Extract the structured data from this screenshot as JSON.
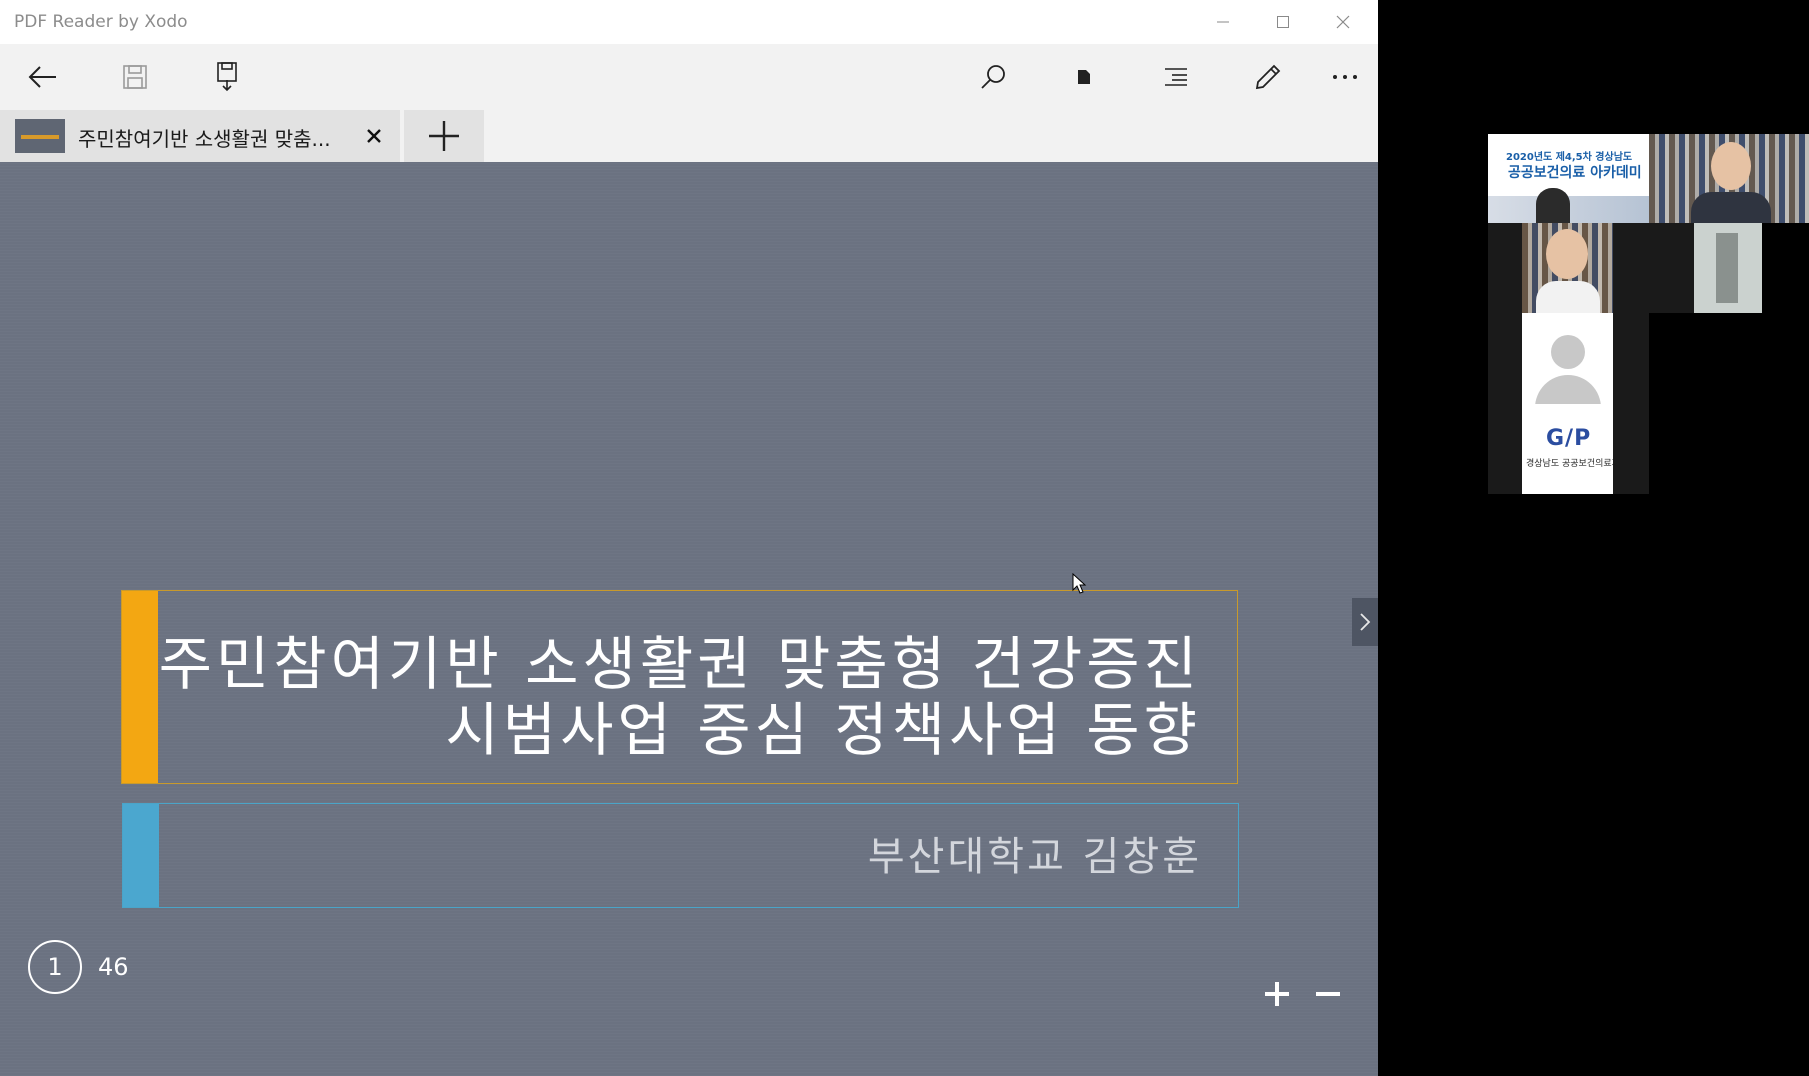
{
  "window": {
    "title": "PDF Reader by Xodo"
  },
  "toolbar": {
    "icons": [
      "back-arrow-icon",
      "save-icon",
      "save-as-icon",
      "search-icon",
      "bookmark-icon",
      "outline-icon",
      "pencil-icon",
      "more-icon"
    ]
  },
  "tab": {
    "title": "주민참여기반 소생활권 맞춤...",
    "close_icon": "close-icon",
    "new_tab_icon": "plus-icon"
  },
  "slide": {
    "title_line1": "주민참여기반 소생활권 맞춤형 건강증진",
    "title_line2": "시범사업 중심 정책사업 동향",
    "subtitle": "부산대학교 김창훈",
    "title_accent_color": "#f3a712",
    "subtitle_accent_color": "#4ba7cf"
  },
  "pager": {
    "current_page": "1",
    "total_pages": "46"
  },
  "zoom": {
    "zoom_in_icon": "plus-icon",
    "zoom_out_icon": "minus-icon"
  },
  "video_gallery": {
    "banner_line1": "2020년도 제4,5차 경상남도",
    "banner_line2": "공공보건의료 아카데미",
    "logo_text": "G/P",
    "logo_org": "경상남도 공공보건의료지원단"
  }
}
